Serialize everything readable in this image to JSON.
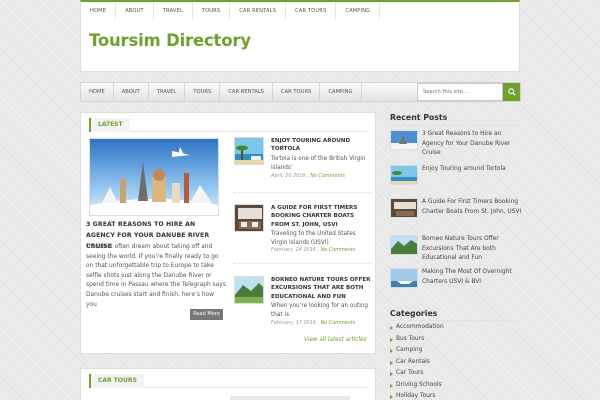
{
  "top_nav": [
    "HOME",
    "ABOUT",
    "TRAVEL",
    "TOURS",
    "CAR RENTALS",
    "CAR TOURS",
    "CAMPING"
  ],
  "site_title": "Toursim Directory",
  "main_nav": [
    "HOME",
    "ABOUT",
    "TRAVEL",
    "TOURS",
    "CAR RENTALS",
    "CAR TOURS",
    "CAMPING"
  ],
  "search": {
    "placeholder": "Search this site...",
    "icon": "search-icon"
  },
  "latest": {
    "heading": "LATEST",
    "featured": {
      "title": "3 GREAT REASONS TO HIRE AN AGENCY FOR YOUR DANUBE RIVER CRUISE",
      "excerpt": "Travelers often dream about taking off and seeing the world. If you’re finally ready to go on that unforgettable trip to Europe to take selfie shots just along the Danube River or spend time in Passau where the Telegraph says Danube cruises start and finish, here’s how you",
      "read_more": "Read More"
    },
    "side_posts": [
      {
        "title": "ENJOY TOURING AROUND TORTOLA",
        "excerpt": "Tortola is one of the British Virgin Islands’",
        "date": "April, 20 2016",
        "comments": "No Comments"
      },
      {
        "title": "A GUIDE FOR FIRST TIMERS BOOKING CHARTER BOATS FROM ST. JOHN, USVI",
        "excerpt": "Traveling to the United States Virgin Islands (USVI)",
        "date": "February, 24 2016",
        "comments": "No Comments"
      },
      {
        "title": "BORNEO NATURE TOURS OFFER EXCURSIONS THAT ARE BOTH EDUCATIONAL AND FUN",
        "excerpt": "When you’re looking for an outing that is",
        "date": "February, 17 2016",
        "comments": "No Comments"
      }
    ],
    "view_all": "View all latest articles"
  },
  "car_tours": {
    "heading": "CAR TOURS"
  },
  "sidebar": {
    "recent_heading": "Recent Posts",
    "recent_posts": [
      "3 Great Reasons to Hire an Agency for Your Danube River Cruise",
      "Enjoy Touring around Tortola",
      "A Guide For First Timers Booking Charter Boats From St. John, USVI",
      "Borneo Nature Tours Offer Excursions That Are both Educational and Fun",
      "Making The Most Of Overnight Charters USVI & BVI"
    ],
    "categories_heading": "Categories",
    "categories": [
      "Accommodation",
      "Bus Tours",
      "Camping",
      "Car Rentals",
      "Car Tours",
      "Driving Schools",
      "Holiday Tours"
    ]
  },
  "colors": {
    "accent": "#6fa12d",
    "text": "#555555",
    "title": "#333333"
  }
}
